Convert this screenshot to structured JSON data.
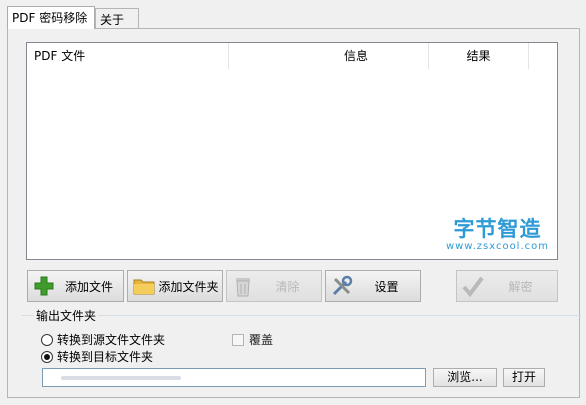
{
  "tabs": [
    "PDF 密码移除",
    "关于"
  ],
  "list": {
    "columns": [
      "PDF 文件",
      "信息",
      "结果"
    ],
    "watermark_title": "字节智造",
    "watermark_url": "www.zsxcool.com"
  },
  "buttons": {
    "add_file": "添加文件",
    "add_folder": "添加文件夹",
    "clear": "清除",
    "settings": "设置",
    "decrypt": "解密"
  },
  "output": {
    "legend": "输出文件夹",
    "radio_source": "转换到源文件文件夹",
    "radio_target": "转换到目标文件夹",
    "overwrite": "覆盖",
    "selected": "radio_target",
    "browse": "浏览...",
    "open": "打开"
  },
  "icons": {
    "add_file": "plus-icon",
    "add_folder": "folder-icon",
    "clear": "trash-icon",
    "settings": "tools-icon",
    "decrypt": "checkmark-icon"
  },
  "colors": {
    "accent": "#2e9bd6",
    "plus": "#3f9b2a",
    "folder": "#e7b63a"
  }
}
